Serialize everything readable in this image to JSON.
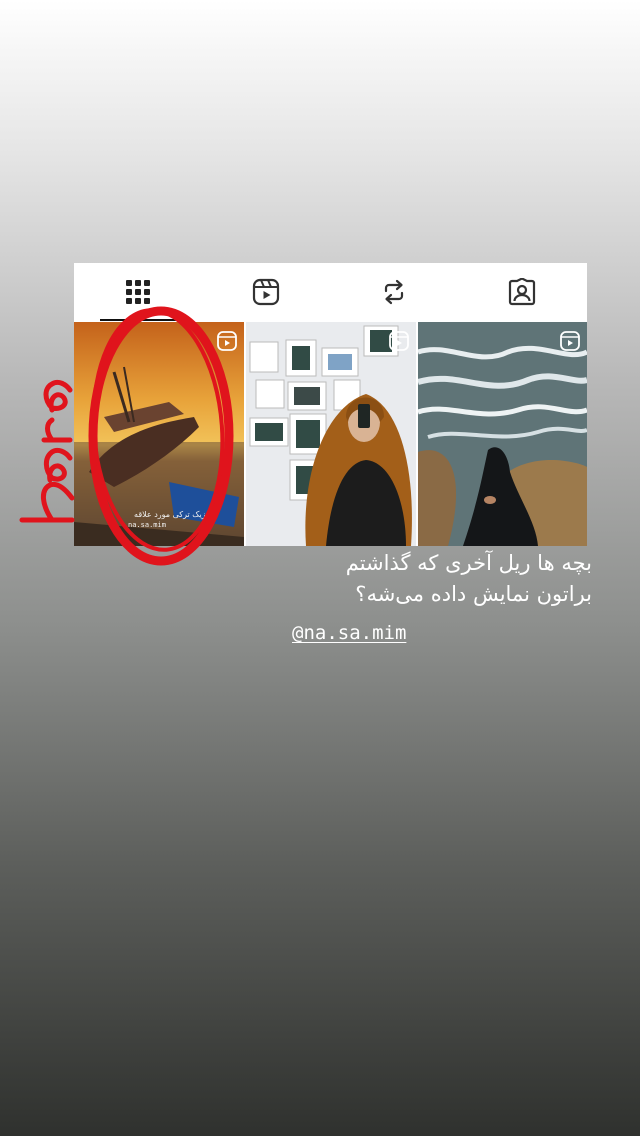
{
  "profile_tabs": [
    {
      "id": "posts",
      "icon": "grid-icon",
      "active": true
    },
    {
      "id": "reels",
      "icon": "reels-icon",
      "active": false
    },
    {
      "id": "reposts",
      "icon": "repost-icon",
      "active": false
    },
    {
      "id": "tagged",
      "icon": "tagged-icon",
      "active": false
    }
  ],
  "grid": [
    {
      "id": "reel-1",
      "subject": "boat at sunset",
      "badge": "reel-icon",
      "overlay_text": "موزیک ترکی مورد علاقه",
      "overlay_handle": "na.sa.mim"
    },
    {
      "id": "reel-2",
      "subject": "mirror selfie",
      "badge": "reel-icon"
    },
    {
      "id": "reel-3",
      "subject": "sea waves and rocks",
      "badge": "reel-icon"
    }
  ],
  "annotation": {
    "text": "here",
    "color": "#e0141c"
  },
  "caption": {
    "line1": "بچه ها ریل آخری که گذاشتم",
    "line2": "براتون نمایش داده می‌شه؟"
  },
  "mention": "@na.sa.mim"
}
